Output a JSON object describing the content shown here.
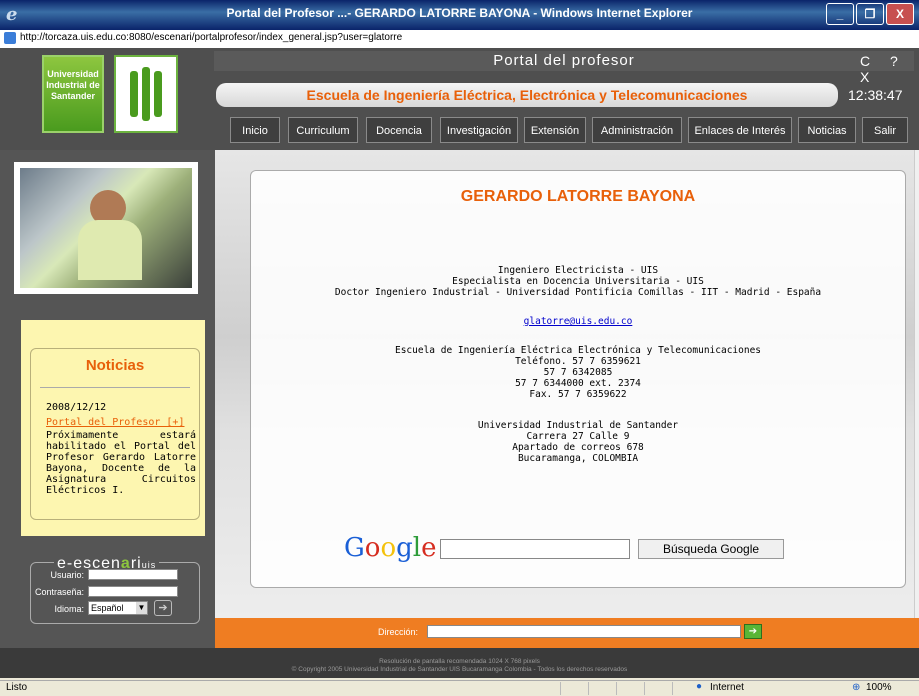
{
  "window": {
    "title": "Portal del Profesor ...- GERARDO LATORRE BAYONA - Windows Internet Explorer",
    "minimize": "_",
    "maximize": "❐",
    "close": "X"
  },
  "address": {
    "url": "http://torcaza.uis.edu.co:8080/escenari/portalprofesor/index_general.jsp?user=glatorre"
  },
  "header": {
    "logo_text": "Universidad Industrial de Santander",
    "portal_title": "Portal del profesor",
    "corner_icons": "C ? X",
    "school": "Escuela de Ingeniería Eléctrica, Electrónica y Telecomunicaciones",
    "clock": "12:38:47"
  },
  "nav": {
    "inicio": "Inicio",
    "curriculum": "Curriculum",
    "docencia": "Docencia",
    "investigacion": "Investigación",
    "extension": "Extensión",
    "administracion": "Administración",
    "enlaces": "Enlaces de Interés",
    "noticias": "Noticias",
    "salir": "Salir"
  },
  "news": {
    "title": "Noticias",
    "date": "2008/12/12",
    "link": "Portal del Profesor [+]",
    "body": "Próximamente estará habilitado el Portal del Profesor Gerardo Latorre Bayona, Docente de la Asignatura Circuitos Eléctricos I."
  },
  "login": {
    "logo_a": "e-escen",
    "logo_b": "a",
    "logo_c": "ri",
    "logo_d": "uis",
    "usuario_label": "Usuario:",
    "password_label": "Contraseña:",
    "idioma_label": "Idioma:",
    "idioma_value": "Español"
  },
  "profile": {
    "name": "GERARDO LATORRE BAYONA",
    "titles": [
      "Ingeniero Electricista - UIS",
      "Especialista en Docencia Universitaria - UIS",
      "Doctor Ingeniero Industrial - Universidad Pontificia Comillas - IIT - Madrid - España"
    ],
    "email": "glatorre@uis.edu.co",
    "contact": [
      "Escuela de Ingeniería Eléctrica Electrónica y Telecomunicaciones",
      "Teléfono.  57 7 6359621",
      "57 7 6342085",
      "57 7 6344000 ext. 2374",
      "Fax. 57 7 6359622"
    ],
    "address": [
      "Universidad Industrial de Santander",
      "Carrera 27 Calle 9",
      "Apartado de correos 678",
      "Bucaramanga, COLOMBIA"
    ]
  },
  "google": {
    "logo": "Google",
    "button": "Búsqueda Google"
  },
  "direccion": {
    "label": "Dirección:"
  },
  "footer": {
    "line1": "Resolución de pantalla recomendada 1024 X 768 pixels",
    "line2": "© Copyright 2005 Universidad Industrial de Santander UIS Bucaramanga Colombia - Todos los derechos reservados"
  },
  "status": {
    "left": "Listo",
    "zone": "Internet",
    "zoom": "100%"
  }
}
